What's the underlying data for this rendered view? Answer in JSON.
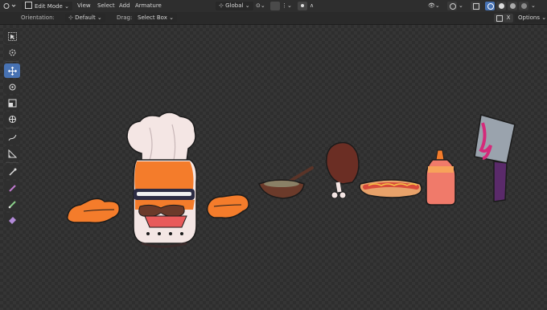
{
  "header": {
    "mode_label": "Edit Mode",
    "menus": [
      "View",
      "Select",
      "Add",
      "Armature"
    ],
    "transform_orientation": "Global"
  },
  "tool_header": {
    "orientation_label": "Orientation:",
    "orientation_value": "Default",
    "drag_label": "Drag:",
    "drag_value": "Select Box",
    "options_label": "Options",
    "close_x": "X"
  },
  "toolbar": {
    "tools": [
      "select-box",
      "cursor",
      "move",
      "rotate",
      "scale",
      "transform",
      "annotate",
      "measure",
      "roll",
      "bone-size",
      "envelope",
      "bone-role",
      "pose"
    ],
    "active_tool": "move"
  },
  "colors": {
    "header_bg": "#2e2e2e",
    "viewport_bg": "#353535",
    "active_blue": "#4772b3",
    "chef_orange": "#f47c2b",
    "hat_white": "#f4e6e4",
    "ketchup_red": "#e84a4a",
    "cleaver_blood": "#d42a7a"
  }
}
